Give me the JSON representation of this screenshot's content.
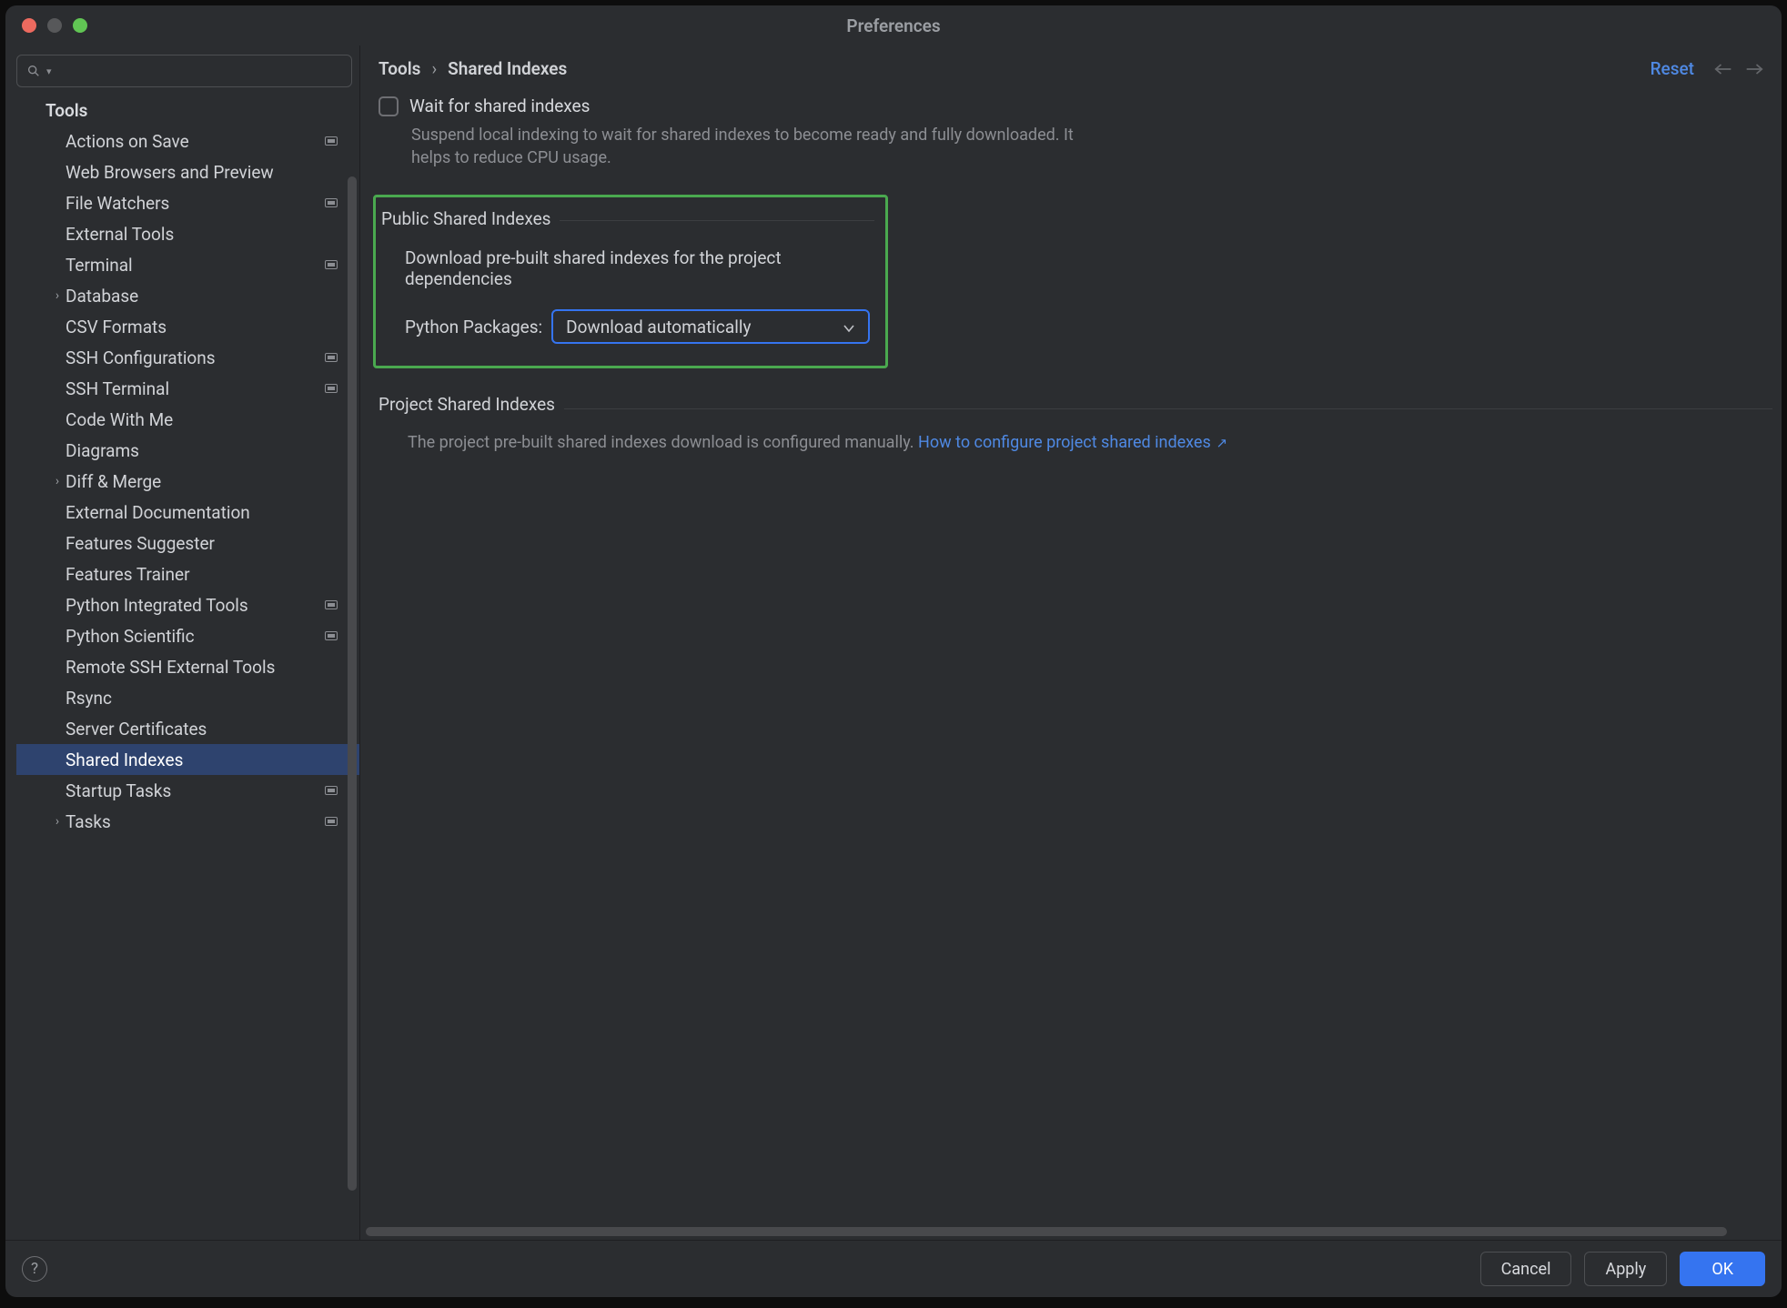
{
  "window": {
    "title": "Preferences"
  },
  "breadcrumb": {
    "root": "Tools",
    "leaf": "Shared Indexes"
  },
  "header": {
    "reset": "Reset"
  },
  "sidebar": {
    "section": "Tools",
    "items": [
      {
        "label": "Actions on Save",
        "hasCaret": false,
        "modIcon": true
      },
      {
        "label": "Web Browsers and Preview",
        "hasCaret": false,
        "modIcon": false
      },
      {
        "label": "File Watchers",
        "hasCaret": false,
        "modIcon": true
      },
      {
        "label": "External Tools",
        "hasCaret": false,
        "modIcon": false
      },
      {
        "label": "Terminal",
        "hasCaret": false,
        "modIcon": true
      },
      {
        "label": "Database",
        "hasCaret": true,
        "modIcon": false
      },
      {
        "label": "CSV Formats",
        "hasCaret": false,
        "modIcon": false
      },
      {
        "label": "SSH Configurations",
        "hasCaret": false,
        "modIcon": true
      },
      {
        "label": "SSH Terminal",
        "hasCaret": false,
        "modIcon": true
      },
      {
        "label": "Code With Me",
        "hasCaret": false,
        "modIcon": false
      },
      {
        "label": "Diagrams",
        "hasCaret": false,
        "modIcon": false
      },
      {
        "label": "Diff & Merge",
        "hasCaret": true,
        "modIcon": false
      },
      {
        "label": "External Documentation",
        "hasCaret": false,
        "modIcon": false
      },
      {
        "label": "Features Suggester",
        "hasCaret": false,
        "modIcon": false
      },
      {
        "label": "Features Trainer",
        "hasCaret": false,
        "modIcon": false
      },
      {
        "label": "Python Integrated Tools",
        "hasCaret": false,
        "modIcon": true
      },
      {
        "label": "Python Scientific",
        "hasCaret": false,
        "modIcon": true
      },
      {
        "label": "Remote SSH External Tools",
        "hasCaret": false,
        "modIcon": false
      },
      {
        "label": "Rsync",
        "hasCaret": false,
        "modIcon": false
      },
      {
        "label": "Server Certificates",
        "hasCaret": false,
        "modIcon": false
      },
      {
        "label": "Shared Indexes",
        "hasCaret": false,
        "modIcon": false,
        "selected": true
      },
      {
        "label": "Startup Tasks",
        "hasCaret": false,
        "modIcon": true
      },
      {
        "label": "Tasks",
        "hasCaret": true,
        "modIcon": true
      }
    ]
  },
  "settings": {
    "wait": {
      "label": "Wait for shared indexes",
      "help": "Suspend local indexing to wait for shared indexes to become ready and fully downloaded. It helps to reduce CPU usage."
    },
    "public": {
      "title": "Public Shared Indexes",
      "desc": "Download pre-built shared indexes for the project dependencies",
      "pythonLabel": "Python Packages:",
      "pythonValue": "Download automatically"
    },
    "project": {
      "title": "Project Shared Indexes",
      "desc": "The project pre-built shared indexes download is configured manually.",
      "link": "How to configure project shared indexes"
    }
  },
  "footer": {
    "cancel": "Cancel",
    "apply": "Apply",
    "ok": "OK"
  }
}
